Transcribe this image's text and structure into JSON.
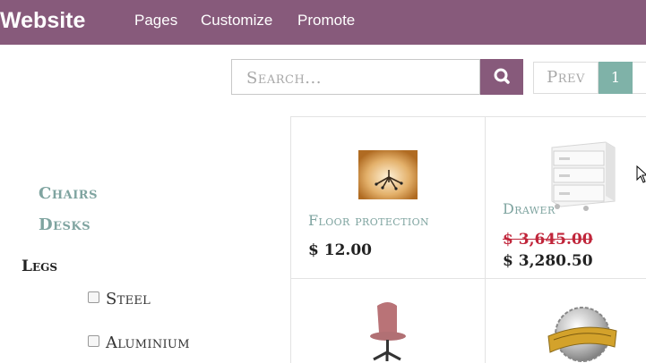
{
  "header": {
    "brand": "Website",
    "menu": [
      {
        "label": "Pages"
      },
      {
        "label": "Customize"
      },
      {
        "label": "Promote"
      }
    ],
    "color": "#875a7b"
  },
  "search": {
    "placeholder": "Search...",
    "button_icon": "search-icon"
  },
  "pager": {
    "prev_label": "Prev",
    "current_page": "1",
    "active_color": "#7fb2a8"
  },
  "sidebar": {
    "categories": [
      {
        "label": "Chairs"
      },
      {
        "label": "Desks"
      }
    ],
    "attribute": {
      "title": "Legs",
      "options": [
        {
          "label": "Steel",
          "checked": false
        },
        {
          "label": "Aluminium",
          "checked": false
        }
      ]
    }
  },
  "products": [
    {
      "name": "Floor protection",
      "price": "$ 12.00",
      "image": "floor-mat-image"
    },
    {
      "name": "Drawer",
      "old_price": "$ 3,645.00",
      "price": "$ 3,280.50",
      "image": "drawer-image"
    },
    {
      "name": "",
      "image": "chair-image"
    },
    {
      "name": "",
      "image": "warranty-badge-image"
    }
  ]
}
